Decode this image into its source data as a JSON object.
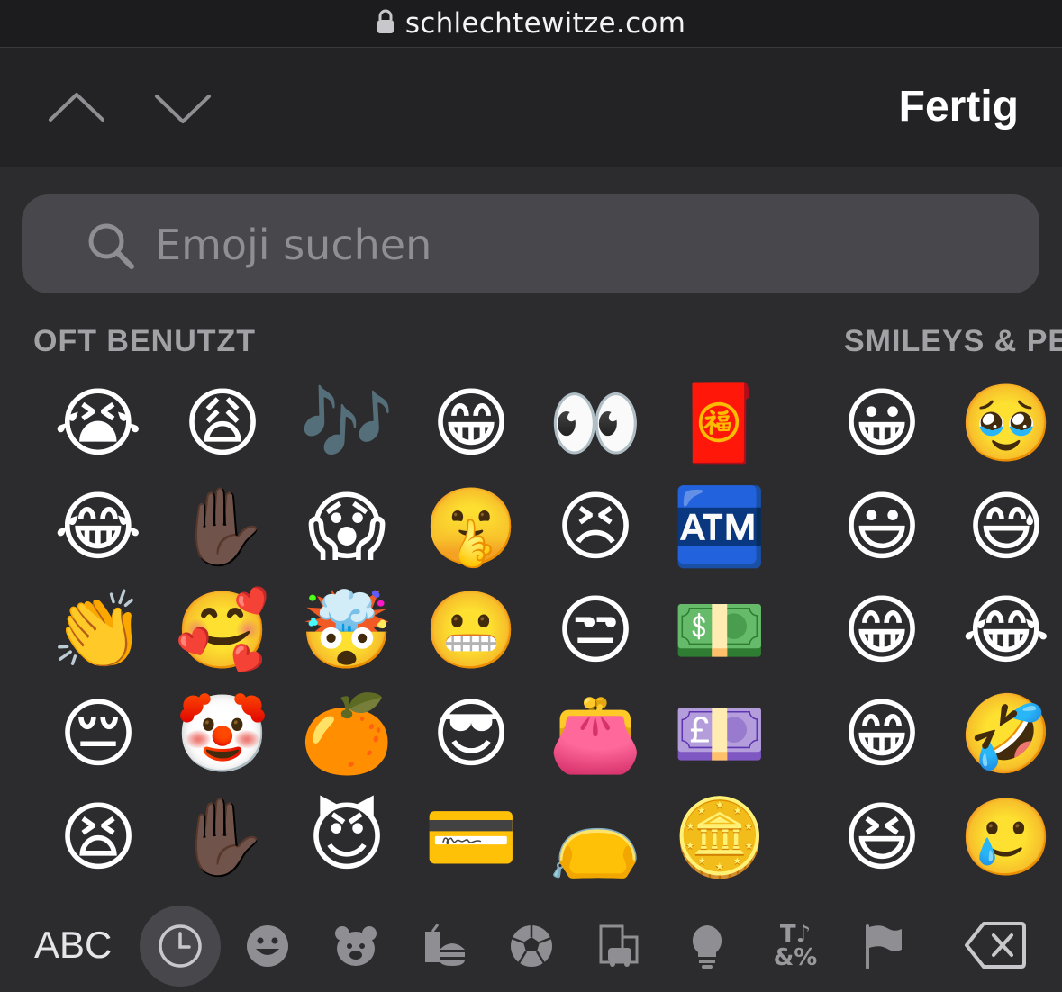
{
  "browser": {
    "url": "schlechtewitze.com"
  },
  "toolbar": {
    "done_label": "Fertig"
  },
  "search": {
    "placeholder": "Emoji suchen"
  },
  "sections": {
    "frequently_used": "OFT BENUTZT",
    "smileys": "SMILEYS & PE"
  },
  "frequently_used_emojis": [
    [
      "😭",
      "😂",
      "👏",
      "😔",
      "😫"
    ],
    [
      "😩",
      "✋🏿",
      "🥰",
      "🤡",
      "✋🏿"
    ],
    [
      "🎶",
      "😱",
      "🤯",
      "🍊",
      "😈"
    ],
    [
      "😁",
      "🤫",
      "😬",
      "😎",
      "💳"
    ],
    [
      "👀",
      "😣",
      "😒",
      "👛",
      "👝"
    ],
    [
      "🧧",
      "🏧",
      "💵",
      "💷",
      "🪙"
    ]
  ],
  "smiley_emojis": [
    [
      "😀",
      "😃",
      "😁",
      "😁",
      "😆"
    ],
    [
      "🥹",
      "😅",
      "😂",
      "🤣",
      "🥲"
    ]
  ],
  "keyboard": {
    "abc_label": "ABC",
    "categories": [
      "recent-clock-icon",
      "smiley-icon",
      "animal-icon",
      "food-icon",
      "activity-icon",
      "travel-icon",
      "objects-icon",
      "symbols-icon",
      "flags-icon"
    ],
    "selected_category": "recent-clock-icon",
    "symbols_glyph": "T♪\n&%"
  }
}
